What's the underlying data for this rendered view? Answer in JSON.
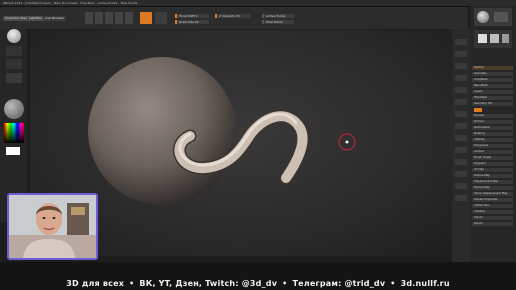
{
  "window": {
    "title": "ZBrush 2023 - [Untitled Project] - Main Document - Free Mem - Active Points - Total Points"
  },
  "toolbar": {
    "left_buttons": [
      "Projection Master",
      "LightBox",
      "Live Boolean"
    ],
    "sliders": [
      "Focal Shift 0",
      "Draw Size 64",
      "Dynamic"
    ],
    "mode_buttons": [
      "Edit",
      "Draw",
      "Move",
      "Scale",
      "Rotate"
    ],
    "right_sliders": [
      "Z Intensity 25",
      "Active Points",
      "Total Points"
    ]
  },
  "right_panel": {
    "rows": [
      "SubTool",
      "Geometry",
      "ArrayMesh",
      "NanoMesh",
      "Layers",
      "FiberMesh",
      "Geometry HD",
      "Preview",
      "Surface",
      "Deformation",
      "Masking",
      "Visibility",
      "Polygroups",
      "Contact",
      "Morph Target",
      "Polypaint",
      "UV Map",
      "Texture Map",
      "Displacement Map",
      "Normal Map",
      "Vector Displacement Map",
      "Display Properties",
      "Unified Skin",
      "Initialize",
      "Import",
      "Export"
    ]
  },
  "footer": {
    "banner_items": [
      "3D для всех",
      "ВК, YT, Дзен, Twitch: @3d_dv",
      "Телеграм: @trid_dv",
      "3d.nullf.ru"
    ],
    "separator": "•"
  }
}
